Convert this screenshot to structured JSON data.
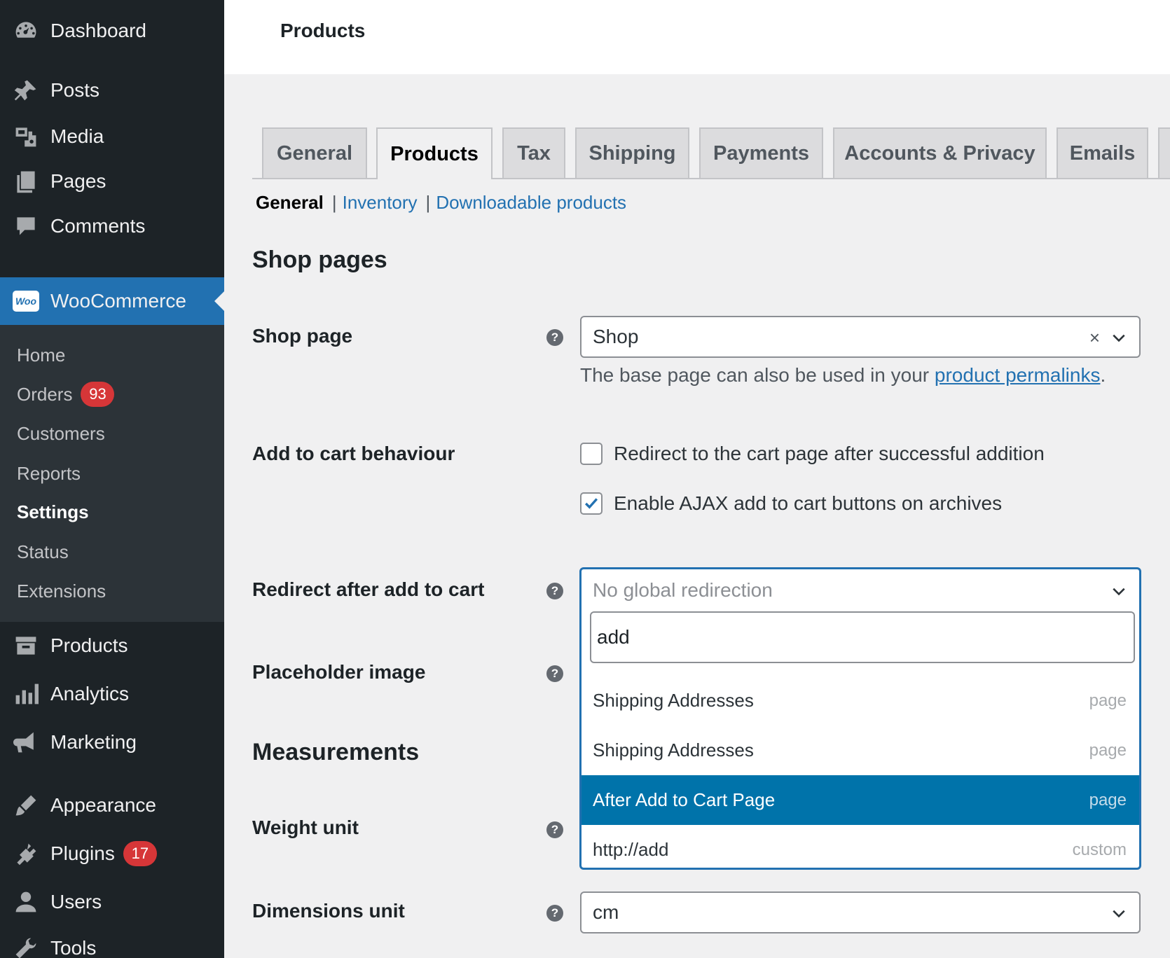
{
  "sidebar": {
    "top_items": [
      {
        "label": "Dashboard",
        "icon": "dashboard-icon"
      },
      {
        "label": "Posts",
        "icon": "pin-icon"
      },
      {
        "label": "Media",
        "icon": "media-icon"
      },
      {
        "label": "Pages",
        "icon": "pages-icon"
      },
      {
        "label": "Comments",
        "icon": "comment-icon"
      }
    ],
    "woocommerce": {
      "label": "WooCommerce",
      "logo": "Woo"
    },
    "submenu": [
      {
        "label": "Home"
      },
      {
        "label": "Orders",
        "badge": "93"
      },
      {
        "label": "Customers"
      },
      {
        "label": "Reports"
      },
      {
        "label": "Settings"
      },
      {
        "label": "Status"
      },
      {
        "label": "Extensions"
      }
    ],
    "bottom_items": [
      {
        "label": "Products",
        "icon": "archive-icon"
      },
      {
        "label": "Analytics",
        "icon": "bar-chart-icon"
      },
      {
        "label": "Marketing",
        "icon": "megaphone-icon"
      },
      {
        "label": "Appearance",
        "icon": "brush-icon"
      },
      {
        "label": "Plugins",
        "icon": "plug-icon",
        "badge": "17"
      },
      {
        "label": "Users",
        "icon": "user-icon"
      },
      {
        "label": "Tools",
        "icon": "wrench-icon"
      }
    ]
  },
  "header": {
    "title": "Products"
  },
  "tabs": [
    "General",
    "Products",
    "Tax",
    "Shipping",
    "Payments",
    "Accounts & Privacy",
    "Emails"
  ],
  "active_tab": "Products",
  "subnav": {
    "current": "General",
    "links": [
      "Inventory",
      "Downloadable products"
    ]
  },
  "sections": {
    "shop_pages": "Shop pages",
    "measurements": "Measurements"
  },
  "fields": {
    "shop_page": {
      "label": "Shop page",
      "value": "Shop",
      "clear": "×",
      "desc_prefix": "The base page can also be used in your ",
      "desc_link": "product permalinks",
      "desc_suffix": "."
    },
    "add_to_cart": {
      "label": "Add to cart behaviour",
      "options": [
        {
          "label": "Redirect to the cart page after successful addition",
          "checked": false
        },
        {
          "label": "Enable AJAX add to cart buttons on archives",
          "checked": true
        }
      ]
    },
    "redirect": {
      "label": "Redirect after add to cart",
      "placeholder": "No global redirection",
      "search_value": "add",
      "results": [
        {
          "name": "Shipping Addresses",
          "type": "page",
          "highlighted": false
        },
        {
          "name": "Shipping Addresses",
          "type": "page",
          "highlighted": false
        },
        {
          "name": "After Add to Cart Page",
          "type": "page",
          "highlighted": true
        },
        {
          "name": "http://add",
          "type": "custom",
          "highlighted": false
        }
      ]
    },
    "placeholder_image": {
      "label": "Placeholder image"
    },
    "weight_unit": {
      "label": "Weight unit"
    },
    "dimensions_unit": {
      "label": "Dimensions unit",
      "value": "cm"
    }
  },
  "help_glyph": "?",
  "colors": {
    "sidebar_bg": "#1d2327",
    "accent": "#2271b1",
    "highlight": "#0073aa",
    "badge": "#d63638"
  }
}
